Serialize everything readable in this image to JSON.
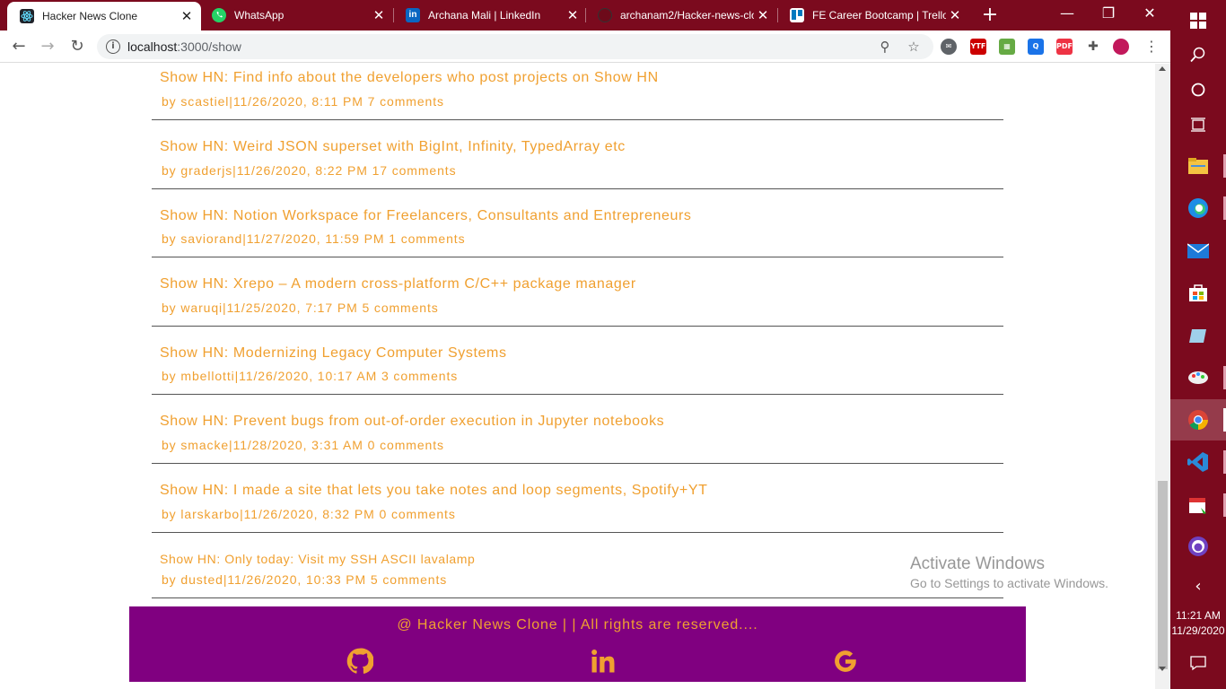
{
  "browser": {
    "tabs": [
      {
        "label": "Hacker News Clone",
        "active": true,
        "icon": "react-icon"
      },
      {
        "label": "WhatsApp",
        "active": false,
        "icon": "whatsapp-icon"
      },
      {
        "label": "Archana Mali | LinkedIn",
        "active": false,
        "icon": "linkedin-icon"
      },
      {
        "label": "archanam2/Hacker-news-clo",
        "active": false,
        "icon": "github-icon"
      },
      {
        "label": "FE Career Bootcamp | Trello",
        "active": false,
        "icon": "trello-icon"
      }
    ],
    "url_host": "localhost",
    "url_path": ":3000/show"
  },
  "posts": [
    {
      "title": "Show HN: Find info about the developers who post projects on Show HN",
      "author": "scastiel",
      "time": "11/26/2020, 8:11 PM",
      "comments": "7 comments"
    },
    {
      "title": "Show HN: Weird JSON superset with BigInt, Infinity, TypedArray etc",
      "author": "graderjs",
      "time": "11/26/2020, 8:22 PM",
      "comments": "17 comments"
    },
    {
      "title": "Show HN: Notion Workspace for Freelancers, Consultants and Entrepreneurs",
      "author": "saviorand",
      "time": "11/27/2020, 11:59 PM",
      "comments": "1 comments"
    },
    {
      "title": "Show HN: Xrepo – A modern cross-platform C/C++ package manager",
      "author": "waruqi",
      "time": "11/25/2020, 7:17 PM",
      "comments": "5 comments"
    },
    {
      "title": "Show HN: Modernizing Legacy Computer Systems",
      "author": "mbellotti",
      "time": "11/26/2020, 10:17 AM",
      "comments": "3 comments"
    },
    {
      "title": "Show HN: Prevent bugs from out-of-order execution in Jupyter notebooks",
      "author": "smacke",
      "time": "11/28/2020, 3:31 AM",
      "comments": "0 comments"
    },
    {
      "title": "Show HN: I made a site that lets you take notes and loop segments, Spotify+YT",
      "author": "larskarbo",
      "time": "11/26/2020, 8:32 PM",
      "comments": "0 comments"
    },
    {
      "title": "Show HN: Only today: Visit my SSH ASCII lavalamp",
      "author": "dusted",
      "time": "11/26/2020, 10:33 PM",
      "comments": "5 comments"
    }
  ],
  "by_prefix": "by",
  "separator": "|",
  "footer": {
    "text": "@ Hacker News Clone | | All rights are reserved....",
    "icons": [
      "github-icon",
      "linkedin-icon",
      "google-icon"
    ]
  },
  "watermark": {
    "line1": "Activate Windows",
    "line2": "Go to Settings to activate Windows."
  },
  "taskbar": {
    "time": "11:21 AM",
    "date": "11/29/2020"
  },
  "colors": {
    "accent": "#f0a030",
    "footer_bg": "#800080",
    "titlebar": "#7b0a1e"
  }
}
